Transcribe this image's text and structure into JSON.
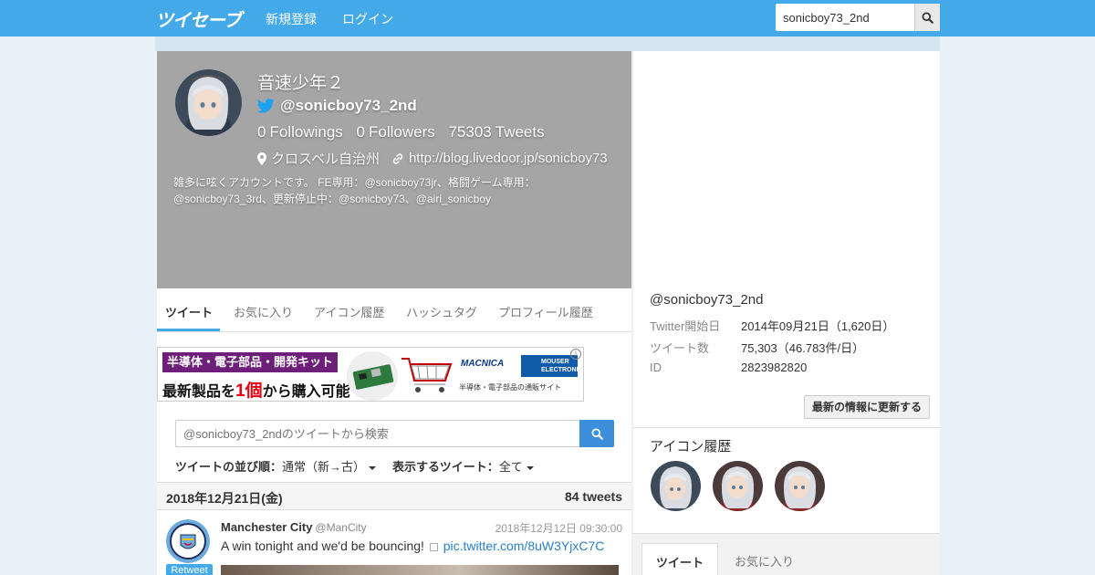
{
  "header": {
    "logo": "ツイセーブ",
    "nav": [
      "新規登録",
      "ログイン"
    ],
    "search_value": "sonicboy73_2nd"
  },
  "profile": {
    "name": "音速少年２",
    "handle": "@sonicboy73_2nd",
    "followings_count": "0",
    "followings_label": "Followings",
    "followers_count": "0",
    "followers_label": "Followers",
    "tweets_count": "75303",
    "tweets_label": "Tweets",
    "location": "クロスベル自治州",
    "url": "http://blog.livedoor.jp/sonicboy73",
    "bio": "雑多に呟くアカウントです。 FE専用：@sonicboy73jr、格闘ゲーム専用：@sonicboy73_3rd、更新停止中：@sonicboy73、@airi_sonicboy"
  },
  "tabs": [
    "ツイート",
    "お気に入り",
    "アイコン履歴",
    "ハッシュタグ",
    "プロフィール履歴"
  ],
  "ad": {
    "line1": "半導体・電子部品・開発キット",
    "line2_pre": "最新製品を",
    "line2_num": "1",
    "line2_red": "個",
    "line2_post": "から購入可能",
    "brand": "MACNICA",
    "mouser": "MOUSER ELECTRONICS",
    "tagline": "半導体・電子部品の通販サイト",
    "info": "i"
  },
  "tweet_search": {
    "placeholder": "@sonicboy73_2ndのツイートから検索"
  },
  "sort": {
    "order_label": "ツイートの並び順：",
    "order_value": "通常（新→古）",
    "show_label": "表示するツイート：",
    "show_value": "全て"
  },
  "date_group": {
    "date": "2018年12月21日(金)",
    "count": "84 tweets"
  },
  "tweet": {
    "name": "Manchester City",
    "handle": "@ManCity",
    "time": "2018年12月12日 09:30:00",
    "text": "A win tonight and we'd be bouncing!",
    "link": "pic.twitter.com/8uW3YjxC7C",
    "badge": "Retweet"
  },
  "side": {
    "handle": "@sonicboy73_2nd",
    "info": [
      {
        "label": "Twitter開始日",
        "value": "2014年09月21日（1,620日）"
      },
      {
        "label": "ツイート数",
        "value": "75,303（46.783件/日）"
      },
      {
        "label": "ID",
        "value": "2823982820"
      }
    ],
    "update_button": "最新の情報に更新する",
    "icon_history_title": "アイコン履歴",
    "bottom_tabs": [
      "ツイート",
      "お気に入り"
    ]
  },
  "colors": {
    "header": "#44a9e8",
    "hero": "#a5a5a5",
    "link": "#2a7fc4",
    "twitter_blue": "#1da1f2"
  }
}
